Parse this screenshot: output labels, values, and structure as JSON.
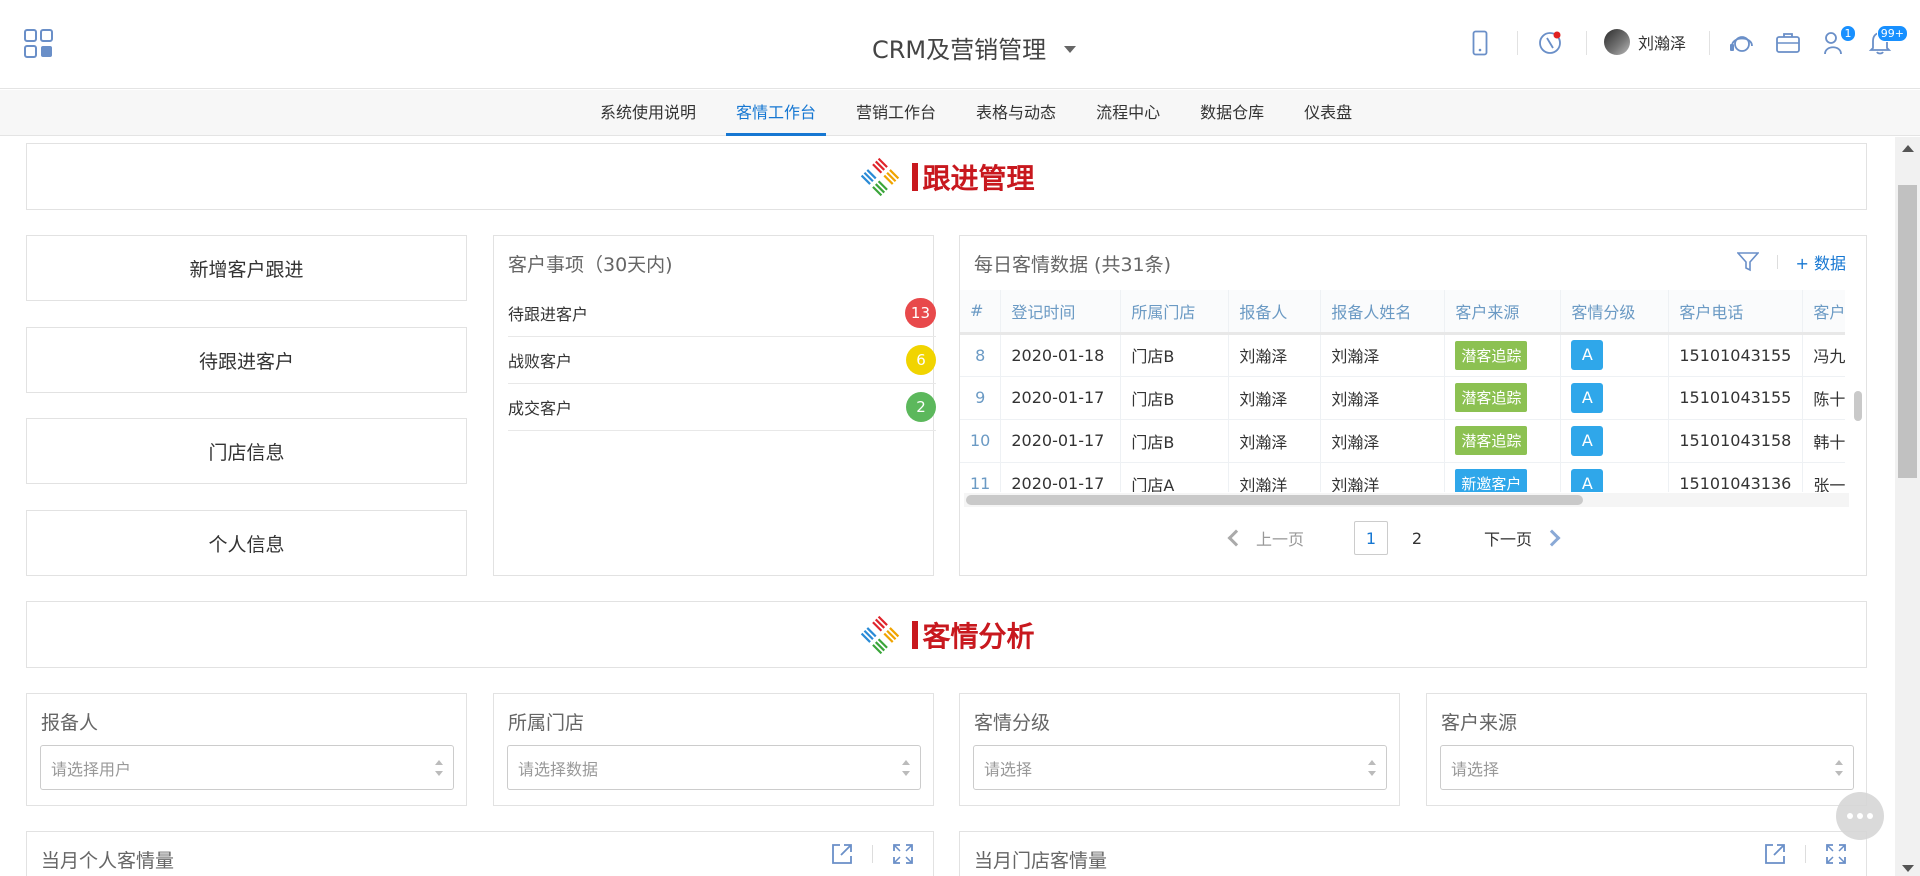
{
  "header": {
    "app_title": "CRM及营销管理",
    "user_name": "刘瀚泽",
    "task_badge": "1",
    "notify_badge": "99+"
  },
  "nav": {
    "tabs": [
      {
        "label": "系统使用说明",
        "active": false
      },
      {
        "label": "客情工作台",
        "active": true
      },
      {
        "label": "营销工作台",
        "active": false
      },
      {
        "label": "表格与动态",
        "active": false
      },
      {
        "label": "流程中心",
        "active": false
      },
      {
        "label": "数据仓库",
        "active": false
      },
      {
        "label": "仪表盘",
        "active": false
      }
    ]
  },
  "sections": {
    "follow_title": "跟进管理",
    "analysis_title": "客情分析"
  },
  "quick_buttons": [
    "新增客户跟进",
    "待跟进客户",
    "门店信息",
    "个人信息"
  ],
  "matters": {
    "title": "客户事项（30天内)",
    "items": [
      {
        "label": "待跟进客户",
        "count": "13",
        "color": "#e8494b"
      },
      {
        "label": "战败客户",
        "count": "6",
        "color": "#f1d400"
      },
      {
        "label": "成交客户",
        "count": "2",
        "color": "#5cb85c"
      }
    ]
  },
  "daily": {
    "title": "每日客情数据 (共31条)",
    "add_label": "+ 数据",
    "columns": [
      "#",
      "登记时间",
      "所属门店",
      "报备人",
      "报备人姓名",
      "客户来源",
      "客情分级",
      "客户电话",
      "客户姓名"
    ],
    "rows": [
      {
        "no": "8",
        "date": "2020-01-18",
        "store": "门店B",
        "reporter": "刘瀚泽",
        "reporter_name": "刘瀚泽",
        "source": "潜客追踪",
        "source_color": "#8cc152",
        "grade": "A",
        "phone": "15101043155",
        "customer": "冯九"
      },
      {
        "no": "9",
        "date": "2020-01-17",
        "store": "门店B",
        "reporter": "刘瀚泽",
        "reporter_name": "刘瀚泽",
        "source": "潜客追踪",
        "source_color": "#8cc152",
        "grade": "A",
        "phone": "15101043155",
        "customer": "陈十"
      },
      {
        "no": "10",
        "date": "2020-01-17",
        "store": "门店B",
        "reporter": "刘瀚泽",
        "reporter_name": "刘瀚泽",
        "source": "潜客追踪",
        "source_color": "#8cc152",
        "grade": "A",
        "phone": "15101043158",
        "customer": "韩十"
      },
      {
        "no": "11",
        "date": "2020-01-17",
        "store": "门店A",
        "reporter": "刘瀚洋",
        "reporter_name": "刘瀚洋",
        "source": "新邀客户",
        "source_color": "#2fa7ea",
        "grade": "A",
        "phone": "15101043136",
        "customer": "张一"
      }
    ],
    "pager": {
      "prev": "上一页",
      "next": "下一页",
      "pages": [
        "1",
        "2"
      ],
      "current": "1"
    }
  },
  "filters": [
    {
      "label": "报备人",
      "placeholder": "请选择用户"
    },
    {
      "label": "所属门店",
      "placeholder": "请选择数据"
    },
    {
      "label": "客情分级",
      "placeholder": "请选择"
    },
    {
      "label": "客户来源",
      "placeholder": "请选择"
    }
  ],
  "charts": {
    "personal_title": "当月个人客情量",
    "store_title": "当月门店客情量"
  }
}
